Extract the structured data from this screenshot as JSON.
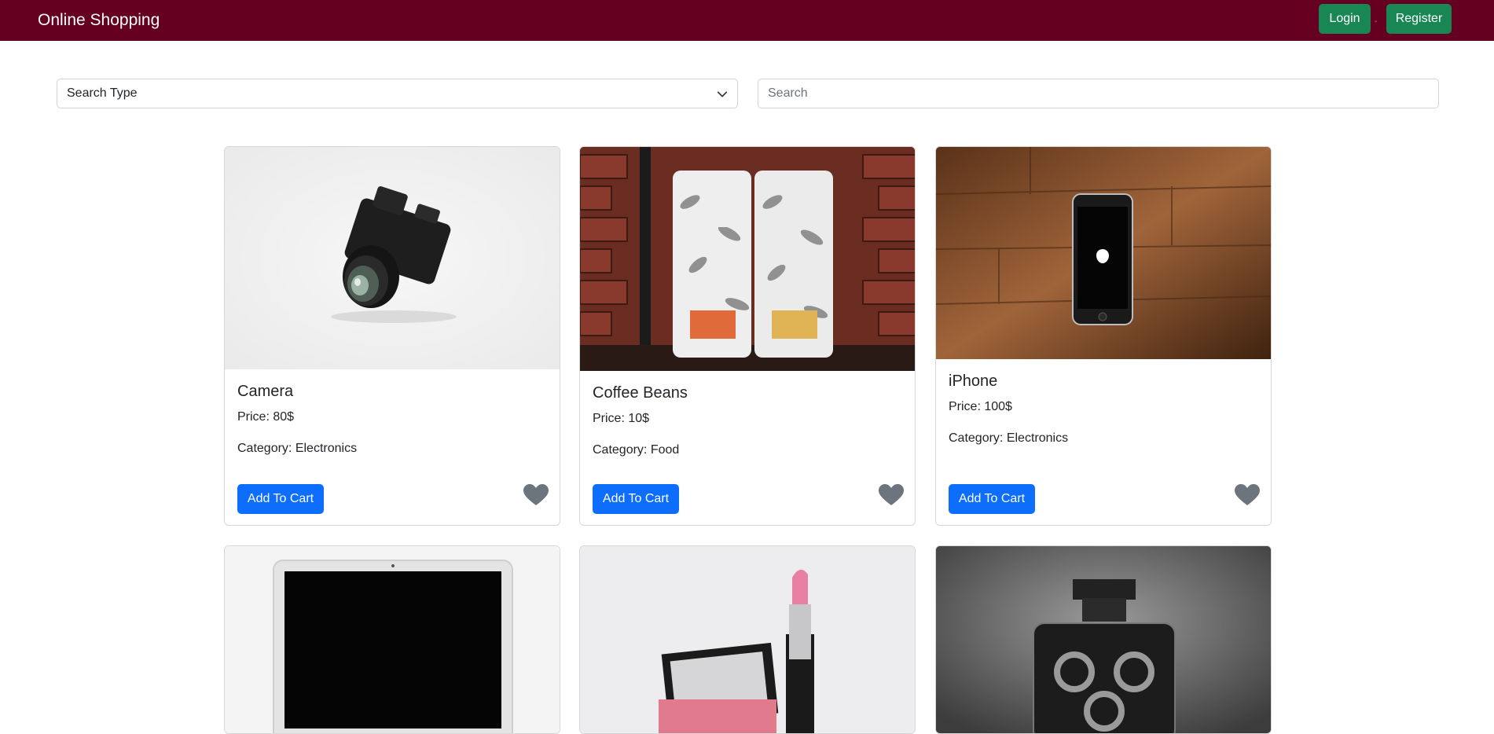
{
  "navbar": {
    "brand": "Online Shopping",
    "login_label": "Login",
    "register_label": "Register",
    "separator": "-",
    "background": "#650020"
  },
  "search": {
    "type_selected": "Search Type",
    "placeholder": "Search"
  },
  "add_to_cart_label": "Add To Cart",
  "products": [
    {
      "title": "Camera",
      "price": "Price: 80$",
      "category": "Category: Electronics",
      "image": "camera"
    },
    {
      "title": "Coffee Beans",
      "price": "Price: 10$",
      "category": "Category: Food",
      "image": "coffee-beans"
    },
    {
      "title": "iPhone",
      "price": "Price: 100$",
      "category": "Category: Electronics",
      "image": "iphone"
    },
    {
      "title": "",
      "price": "",
      "category": "",
      "image": "laptop"
    },
    {
      "title": "",
      "price": "",
      "category": "",
      "image": "lipstick"
    },
    {
      "title": "",
      "price": "",
      "category": "",
      "image": "perfume"
    }
  ],
  "colors": {
    "primary_button": "#0d6efd",
    "success_button": "#198754",
    "heart_icon": "#6c757d"
  },
  "icons": [
    "chevron-down-icon",
    "heart-icon"
  ]
}
